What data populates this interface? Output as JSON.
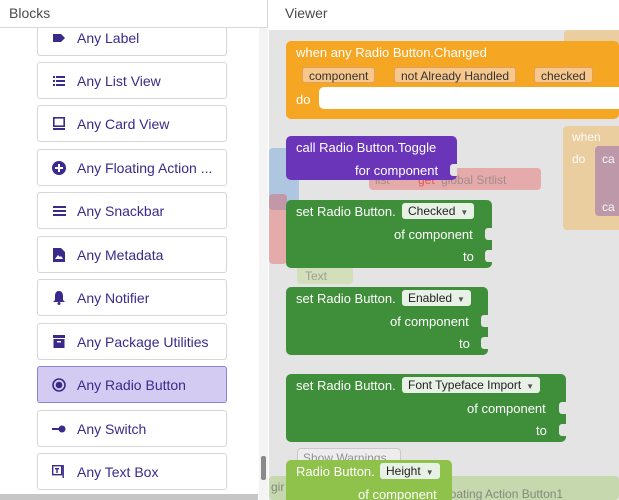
{
  "blocks_panel": {
    "title": "Blocks",
    "items": [
      {
        "label": "Any Label",
        "icon": "label-icon"
      },
      {
        "label": "Any List View",
        "icon": "list-view-icon"
      },
      {
        "label": "Any Card View",
        "icon": "card-view-icon"
      },
      {
        "label": "Any Floating Action ...",
        "icon": "floating-action-icon"
      },
      {
        "label": "Any Snackbar",
        "icon": "snackbar-icon"
      },
      {
        "label": "Any Metadata",
        "icon": "metadata-icon"
      },
      {
        "label": "Any Notifier",
        "icon": "notifier-icon"
      },
      {
        "label": "Any Package Utilities",
        "icon": "package-icon"
      },
      {
        "label": "Any Radio Button",
        "icon": "radio-button-icon",
        "selected": true
      },
      {
        "label": "Any Switch",
        "icon": "switch-icon"
      },
      {
        "label": "Any Text Box",
        "icon": "text-box-icon"
      }
    ]
  },
  "viewer": {
    "title": "Viewer",
    "event_block": {
      "title": "when any Radio Button.Changed",
      "params": [
        "component",
        "not Already Handled",
        "checked"
      ],
      "do_label": "do",
      "color": "#f5a623"
    },
    "call_block": {
      "title": "call Radio Button.Toggle",
      "arg_label": "for component",
      "color": "#6a35b8"
    },
    "setter_blocks": [
      {
        "prefix": "set Radio Button.",
        "property": "Checked",
        "arg1": "of component",
        "arg2": "to"
      },
      {
        "prefix": "set Radio Button.",
        "property": "Enabled",
        "arg1": "of component",
        "arg2": "to"
      },
      {
        "prefix": "set Radio Button.",
        "property": "Font Typeface Import",
        "arg1": "of component",
        "arg2": "to"
      }
    ],
    "getter_block": {
      "prefix": "Radio Button.",
      "property": "Height",
      "arg1": "of component"
    },
    "setter_color": "#3f8f3a",
    "getter_color": "#8fc24a",
    "background_fragments": {
      "when_label": "when",
      "do_label": "do",
      "list_label": "list",
      "get_label": "get",
      "global_var": "global Srtlist",
      "text_label": "Text",
      "show_warnings": "Show Warnings",
      "floating_fragment": "loating  Action  Button1",
      "gir_fragment": "gir",
      "ca1": "ca",
      "ca2": "ca"
    }
  }
}
